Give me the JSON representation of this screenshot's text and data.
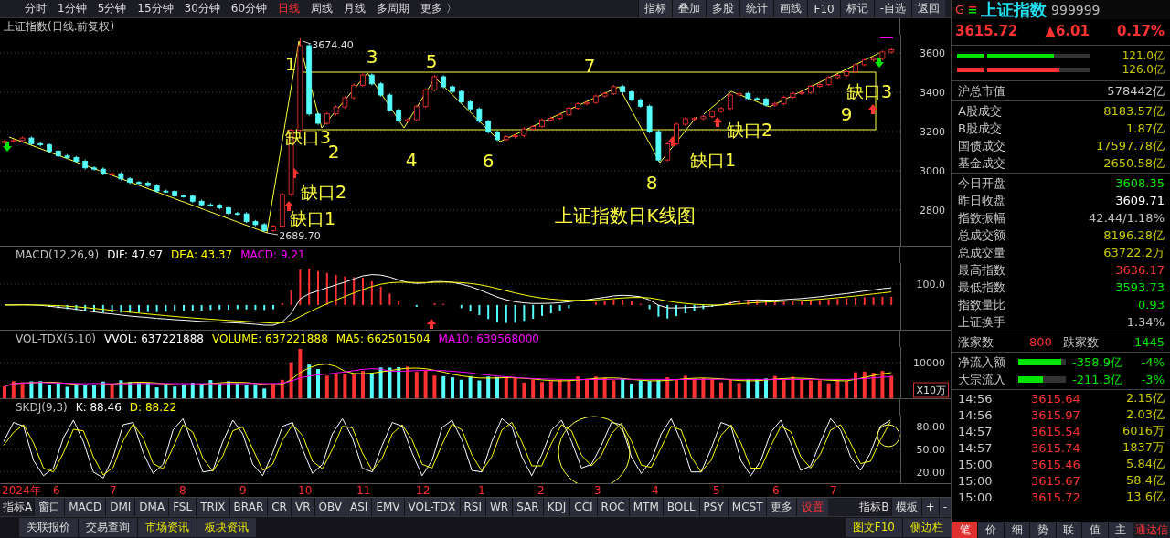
{
  "toolbar": {
    "periods": [
      {
        "label": "分时",
        "selected": false
      },
      {
        "label": "1分钟",
        "selected": false
      },
      {
        "label": "5分钟",
        "selected": false
      },
      {
        "label": "15分钟",
        "selected": false
      },
      {
        "label": "30分钟",
        "selected": false
      },
      {
        "label": "60分钟",
        "selected": false
      },
      {
        "label": "日线",
        "selected": true
      },
      {
        "label": "周线",
        "selected": false
      },
      {
        "label": "月线",
        "selected": false
      },
      {
        "label": "多周期",
        "selected": false
      },
      {
        "label": "更多 〉",
        "selected": false
      }
    ],
    "tools": [
      "指标",
      "叠加",
      "多股",
      "统计",
      "画线",
      "F10",
      "标记",
      "-自选",
      "返回"
    ]
  },
  "price_pane": {
    "title": "上证指数(日线.前复权)",
    "chart_data": {
      "type": "candlestick",
      "grid": true,
      "ylim": [
        2614,
        3693
      ],
      "yticks": [
        {
          "value": 3600,
          "label": "3600"
        },
        {
          "value": 3400,
          "label": "3400"
        },
        {
          "value": 3200,
          "label": "3200"
        },
        {
          "value": 3000,
          "label": "3000"
        },
        {
          "value": 2800,
          "label": "2800"
        }
      ],
      "ohlc": [
        [
          3144,
          3158,
          3136,
          3150
        ],
        [
          3150,
          3162,
          3142,
          3154
        ],
        [
          3154,
          3175,
          3146,
          3167
        ],
        [
          3167,
          3175,
          3130,
          3138
        ],
        [
          3138,
          3146,
          3124,
          3132
        ],
        [
          3132,
          3140,
          3092,
          3100
        ],
        [
          3100,
          3108,
          3068,
          3076
        ],
        [
          3076,
          3084,
          3060,
          3068
        ],
        [
          3068,
          3076,
          3041,
          3049
        ],
        [
          3049,
          3057,
          3007,
          3015
        ],
        [
          3015,
          3023,
          3001,
          3009
        ],
        [
          3009,
          3017,
          2977,
          2985
        ],
        [
          2985,
          2993,
          2977,
          2985
        ],
        [
          2985,
          2993,
          2951,
          2959
        ],
        [
          2959,
          2967,
          2933,
          2941
        ],
        [
          2941,
          2949,
          2930,
          2938
        ],
        [
          2938,
          2946,
          2917,
          2925
        ],
        [
          2925,
          2933,
          2889,
          2897
        ],
        [
          2897,
          2905,
          2887,
          2895
        ],
        [
          2895,
          2903,
          2864,
          2872
        ],
        [
          2872,
          2880,
          2863,
          2871
        ],
        [
          2871,
          2879,
          2837,
          2845
        ],
        [
          2845,
          2853,
          2819,
          2827
        ],
        [
          2827,
          2835,
          2817,
          2825
        ],
        [
          2825,
          2833,
          2804,
          2812
        ],
        [
          2812,
          2820,
          2775,
          2783
        ],
        [
          2783,
          2791,
          2773,
          2781
        ],
        [
          2781,
          2789,
          2734,
          2742
        ],
        [
          2742,
          2750,
          2718,
          2726
        ],
        [
          2726,
          2734,
          2690,
          2695
        ],
        [
          2695,
          2726,
          2690,
          2718
        ],
        [
          2718,
          2888,
          2710,
          2880
        ],
        [
          2880,
          3215,
          2872,
          3207
        ],
        [
          3207,
          3674,
          3199,
          3637
        ],
        [
          3637,
          3645,
          3281,
          3289
        ],
        [
          3289,
          3297,
          3234,
          3242
        ],
        [
          3242,
          3298,
          3234,
          3290
        ],
        [
          3290,
          3333,
          3282,
          3325
        ],
        [
          3325,
          3380,
          3317,
          3372
        ],
        [
          3372,
          3444,
          3364,
          3436
        ],
        [
          3436,
          3496,
          3428,
          3488
        ],
        [
          3488,
          3496,
          3435,
          3443
        ],
        [
          3443,
          3451,
          3378,
          3386
        ],
        [
          3386,
          3394,
          3301,
          3309
        ],
        [
          3309,
          3317,
          3246,
          3254
        ],
        [
          3254,
          3268,
          3246,
          3260
        ],
        [
          3260,
          3335,
          3252,
          3327
        ],
        [
          3327,
          3419,
          3319,
          3411
        ],
        [
          3411,
          3487,
          3403,
          3479
        ],
        [
          3479,
          3487,
          3420,
          3428
        ],
        [
          3428,
          3436,
          3396,
          3404
        ],
        [
          3404,
          3412,
          3343,
          3351
        ],
        [
          3351,
          3359,
          3307,
          3315
        ],
        [
          3315,
          3323,
          3244,
          3252
        ],
        [
          3252,
          3260,
          3190,
          3198
        ],
        [
          3198,
          3206,
          3151,
          3159
        ],
        [
          3159,
          3182,
          3151,
          3174
        ],
        [
          3174,
          3188,
          3166,
          3180
        ],
        [
          3180,
          3221,
          3172,
          3213
        ],
        [
          3213,
          3233,
          3205,
          3225
        ],
        [
          3225,
          3267,
          3217,
          3259
        ],
        [
          3259,
          3276,
          3251,
          3268
        ],
        [
          3268,
          3293,
          3260,
          3285
        ],
        [
          3285,
          3327,
          3277,
          3319
        ],
        [
          3319,
          3349,
          3311,
          3341
        ],
        [
          3341,
          3356,
          3333,
          3348
        ],
        [
          3348,
          3389,
          3340,
          3381
        ],
        [
          3381,
          3402,
          3373,
          3394
        ],
        [
          3394,
          3437,
          3386,
          3429
        ],
        [
          3429,
          3437,
          3394,
          3402
        ],
        [
          3402,
          3410,
          3353,
          3361
        ],
        [
          3361,
          3369,
          3321,
          3329
        ],
        [
          3329,
          3337,
          3192,
          3200
        ],
        [
          3200,
          3208,
          3047,
          3055
        ],
        [
          3055,
          3145,
          3047,
          3137
        ],
        [
          3137,
          3245,
          3129,
          3237
        ],
        [
          3237,
          3273,
          3229,
          3265
        ],
        [
          3265,
          3274,
          3258,
          3266
        ],
        [
          3266,
          3284,
          3258,
          3276
        ],
        [
          3276,
          3310,
          3268,
          3302
        ],
        [
          3302,
          3325,
          3294,
          3317
        ],
        [
          3317,
          3394,
          3309,
          3386
        ],
        [
          3386,
          3402,
          3378,
          3394
        ],
        [
          3394,
          3402,
          3360,
          3368
        ],
        [
          3368,
          3376,
          3357,
          3365
        ],
        [
          3365,
          3373,
          3327,
          3335
        ],
        [
          3335,
          3351,
          3327,
          3343
        ],
        [
          3343,
          3382,
          3335,
          3374
        ],
        [
          3374,
          3402,
          3366,
          3394
        ],
        [
          3394,
          3407,
          3386,
          3399
        ],
        [
          3399,
          3438,
          3391,
          3430
        ],
        [
          3430,
          3448,
          3422,
          3440
        ],
        [
          3440,
          3483,
          3432,
          3475
        ],
        [
          3475,
          3494,
          3467,
          3486
        ],
        [
          3486,
          3513,
          3478,
          3505
        ],
        [
          3505,
          3548,
          3497,
          3540
        ],
        [
          3540,
          3572,
          3532,
          3564
        ],
        [
          3564,
          3580,
          3556,
          3572
        ],
        [
          3572,
          3613,
          3564,
          3605
        ],
        [
          3605,
          3624,
          3597,
          3616
        ]
      ]
    },
    "annotations": [
      {
        "text": "1",
        "kind": "wave"
      },
      {
        "text": "3",
        "kind": "wave"
      },
      {
        "text": "5",
        "kind": "wave"
      },
      {
        "text": "7",
        "kind": "wave"
      },
      {
        "text": "缺口3",
        "kind": "gap"
      },
      {
        "text": "2",
        "kind": "wave"
      },
      {
        "text": "4",
        "kind": "wave"
      },
      {
        "text": "6",
        "kind": "wave"
      },
      {
        "text": "8",
        "kind": "wave"
      },
      {
        "text": "缺口1",
        "kind": "gap"
      },
      {
        "text": "缺口2",
        "kind": "gap"
      },
      {
        "text": "缺口3",
        "kind": "gap"
      },
      {
        "text": "9",
        "kind": "wave"
      },
      {
        "text": "缺口2",
        "kind": "gap"
      },
      {
        "text": "缺口1",
        "kind": "gap"
      },
      {
        "text": "上证指数日K线图",
        "kind": "title"
      },
      {
        "text": "3674.40",
        "kind": "price"
      },
      {
        "text": "2689.70",
        "kind": "price"
      }
    ]
  },
  "macd_pane": {
    "legend": [
      {
        "text": "MACD(12,26,9)",
        "color": "#c0c0c0"
      },
      {
        "text": "DIF: 47.97",
        "color": "#ffffff"
      },
      {
        "text": "DEA: 43.37",
        "color": "#ffff00"
      },
      {
        "text": "MACD: 9.21",
        "color": "#ff00ff"
      }
    ],
    "axis_labels": [
      "100.0"
    ]
  },
  "volume_pane": {
    "legend": [
      {
        "text": "VOL-TDX(5,10)",
        "color": "#c0c0c0"
      },
      {
        "text": "VVOL: 637221888",
        "color": "#ffffff"
      },
      {
        "text": "VOLUME: 637221888",
        "color": "#ffff00"
      },
      {
        "text": "MA5: 662501504",
        "color": "#ffff00"
      },
      {
        "text": "MA10: 639568000",
        "color": "#ff00ff"
      }
    ],
    "axis_labels": [
      "10000"
    ],
    "unit": "X10万"
  },
  "skdj_pane": {
    "legend": [
      {
        "text": "SKDJ(9,3)",
        "color": "#c0c0c0"
      }
    ],
    "chart_data": {
      "type": "line",
      "grid": true,
      "ylim": [
        4,
        94
      ],
      "yticks": [
        {
          "value": 80,
          "label": "80.00"
        },
        {
          "value": 50,
          "label": "50.00"
        },
        {
          "value": 20,
          "label": "20.00"
        }
      ],
      "series": [
        {
          "name": "K: 88.46",
          "color": "#ffffff",
          "values": [
            60,
            85,
            80,
            35,
            15,
            25,
            65,
            88,
            60,
            20,
            12,
            40,
            82,
            85,
            45,
            18,
            30,
            75,
            90,
            55,
            20,
            22,
            60,
            88,
            70,
            30,
            15,
            45,
            80,
            85,
            50,
            18,
            30,
            70,
            90,
            65,
            25,
            20,
            55,
            85,
            80,
            45,
            15,
            35,
            78,
            88,
            62,
            22,
            20,
            60,
            90,
            80,
            40,
            15,
            42,
            75,
            88,
            60,
            25,
            30,
            55,
            85,
            82,
            40,
            18,
            35,
            70,
            90,
            60,
            20,
            20,
            50,
            85,
            80,
            35,
            15,
            35,
            72,
            88,
            58,
            22,
            28,
            60,
            90,
            75,
            40,
            22,
            45,
            80,
            88
          ]
        },
        {
          "name": "D: 88.22",
          "color": "#ffff00",
          "values": [
            55,
            72,
            82,
            58,
            25,
            20,
            45,
            76,
            74,
            40,
            16,
            26,
            61,
            83,
            65,
            31,
            24,
            52,
            82,
            72,
            38,
            21,
            41,
            74,
            79,
            50,
            22,
            30,
            62,
            82,
            68,
            34,
            24,
            50,
            80,
            78,
            45,
            22,
            38,
            70,
            82,
            62,
            30,
            25,
            56,
            83,
            75,
            42,
            21,
            40,
            75,
            85,
            60,
            28,
            28,
            58,
            82,
            74,
            42,
            28,
            42,
            70,
            84,
            61,
            29,
            26,
            52,
            80,
            75,
            40,
            20,
            35,
            68,
            82,
            58,
            25,
            25,
            54,
            80,
            73,
            40,
            25,
            44,
            75,
            82,
            58,
            31,
            34,
            62,
            86
          ]
        }
      ]
    }
  },
  "time_axis": [
    "2024年",
    "6",
    "7",
    "8",
    "9",
    "10",
    "11",
    "12",
    "1",
    "2",
    "3",
    "4",
    "5",
    "6",
    "7"
  ],
  "indicator_tabs": [
    {
      "label": "指标A",
      "kind": "label"
    },
    {
      "label": "窗口",
      "kind": "tab"
    },
    {
      "label": "MACD",
      "kind": "tab"
    },
    {
      "label": "DMI",
      "kind": "tab"
    },
    {
      "label": "DMA",
      "kind": "tab"
    },
    {
      "label": "FSL",
      "kind": "tab"
    },
    {
      "label": "TRIX",
      "kind": "tab"
    },
    {
      "label": "BRAR",
      "kind": "tab"
    },
    {
      "label": "CR",
      "kind": "tab"
    },
    {
      "label": "VR",
      "kind": "tab"
    },
    {
      "label": "OBV",
      "kind": "tab"
    },
    {
      "label": "ASI",
      "kind": "tab"
    },
    {
      "label": "EMV",
      "kind": "tab"
    },
    {
      "label": "VOL-TDX",
      "kind": "tab"
    },
    {
      "label": "RSI",
      "kind": "tab"
    },
    {
      "label": "WR",
      "kind": "tab"
    },
    {
      "label": "SAR",
      "kind": "tab"
    },
    {
      "label": "KDJ",
      "kind": "tab"
    },
    {
      "label": "CCI",
      "kind": "tab"
    },
    {
      "label": "ROC",
      "kind": "tab"
    },
    {
      "label": "MTM",
      "kind": "tab"
    },
    {
      "label": "BOLL",
      "kind": "tab"
    },
    {
      "label": "PSY",
      "kind": "tab"
    },
    {
      "label": "MCST",
      "kind": "tab"
    },
    {
      "label": "更多",
      "kind": "tab"
    },
    {
      "label": "设置",
      "kind": "setting"
    }
  ],
  "indicator_tabs_right": [
    {
      "label": "指标B",
      "kind": "label"
    },
    {
      "label": "模板",
      "kind": "tab"
    },
    {
      "label": "+",
      "kind": "tab"
    },
    {
      "label": "-",
      "kind": "tab"
    }
  ],
  "bottom_bar": {
    "left": [
      {
        "label": "关联报价",
        "kind": "normal"
      },
      {
        "label": "交易查询",
        "kind": "normal"
      },
      {
        "label": "市场资讯",
        "kind": "highlight"
      },
      {
        "label": "板块资讯",
        "kind": "highlight"
      }
    ],
    "right": [
      {
        "label": "图文F10",
        "kind": "highlight"
      },
      {
        "label": "侧边栏",
        "kind": "highlight"
      }
    ]
  },
  "quote": {
    "badge": "G",
    "name": "上证指数",
    "code": "999999",
    "price": "3615.72",
    "change": "▲6.01",
    "change_pct": "0.17%",
    "order_bars": [
      {
        "value": "121.0亿",
        "kind": "sell",
        "level": 0.73
      },
      {
        "value": "126.0亿",
        "kind": "buy",
        "level": 0.77
      }
    ],
    "market_cap": {
      "label": "沪总市值",
      "value": "578442亿"
    },
    "turnover": [
      {
        "label": "A股成交",
        "value": "8183.57亿"
      },
      {
        "label": "B股成交",
        "value": "1.87亿"
      },
      {
        "label": "国债成交",
        "value": "17597.78亿"
      },
      {
        "label": "基金成交",
        "value": "2650.58亿"
      }
    ],
    "stats": [
      {
        "label": "今日开盘",
        "value": "3608.35",
        "kind": "down"
      },
      {
        "label": "昨日收盘",
        "value": "3609.71",
        "kind": "flat"
      },
      {
        "label": "指数振幅",
        "value": "42.44/1.18%",
        "kind": "plain"
      },
      {
        "label": "总成交额",
        "value": "8196.28亿",
        "kind": "amount"
      },
      {
        "label": "总成交量",
        "value": "63722.2万",
        "kind": "amount"
      },
      {
        "label": "最高指数",
        "value": "3636.17",
        "kind": "up"
      },
      {
        "label": "最低指数",
        "value": "3593.73",
        "kind": "down"
      },
      {
        "label": "指数量比",
        "value": "0.93",
        "kind": "down"
      },
      {
        "label": "上证换手",
        "value": "1.34%",
        "kind": "plain"
      }
    ],
    "breadth": {
      "up_label": "涨家数",
      "up": "800",
      "down_label": "跌家数",
      "down": "1445"
    },
    "flows": [
      {
        "label": "净流入额",
        "level": 0.9,
        "amount": "-358.9亿",
        "pct": "-4%"
      },
      {
        "label": "大宗流入",
        "level": 0.52,
        "amount": "-211.3亿",
        "pct": "-3%"
      }
    ],
    "ticks": [
      {
        "time": "14:56",
        "price": "3615.64",
        "volume": "2.15亿"
      },
      {
        "time": "14:56",
        "price": "3615.97",
        "volume": "2.03亿"
      },
      {
        "time": "14:57",
        "price": "3615.54",
        "volume": "6016万"
      },
      {
        "time": "14:57",
        "price": "3615.74",
        "volume": "1837万"
      },
      {
        "time": "15:00",
        "price": "3615.46",
        "volume": "5.84亿"
      },
      {
        "time": "15:00",
        "price": "3615.67",
        "volume": "58.4亿"
      },
      {
        "time": "15:00",
        "price": "3615.72",
        "volume": "13.6亿"
      }
    ],
    "tabs": [
      {
        "label": "笔",
        "selected": true
      },
      {
        "label": "价",
        "selected": false
      },
      {
        "label": "细",
        "selected": false
      },
      {
        "label": "势",
        "selected": false
      },
      {
        "label": "联",
        "selected": false
      },
      {
        "label": "值",
        "selected": false
      },
      {
        "label": "主",
        "selected": false
      }
    ],
    "vendor": "通达信"
  }
}
